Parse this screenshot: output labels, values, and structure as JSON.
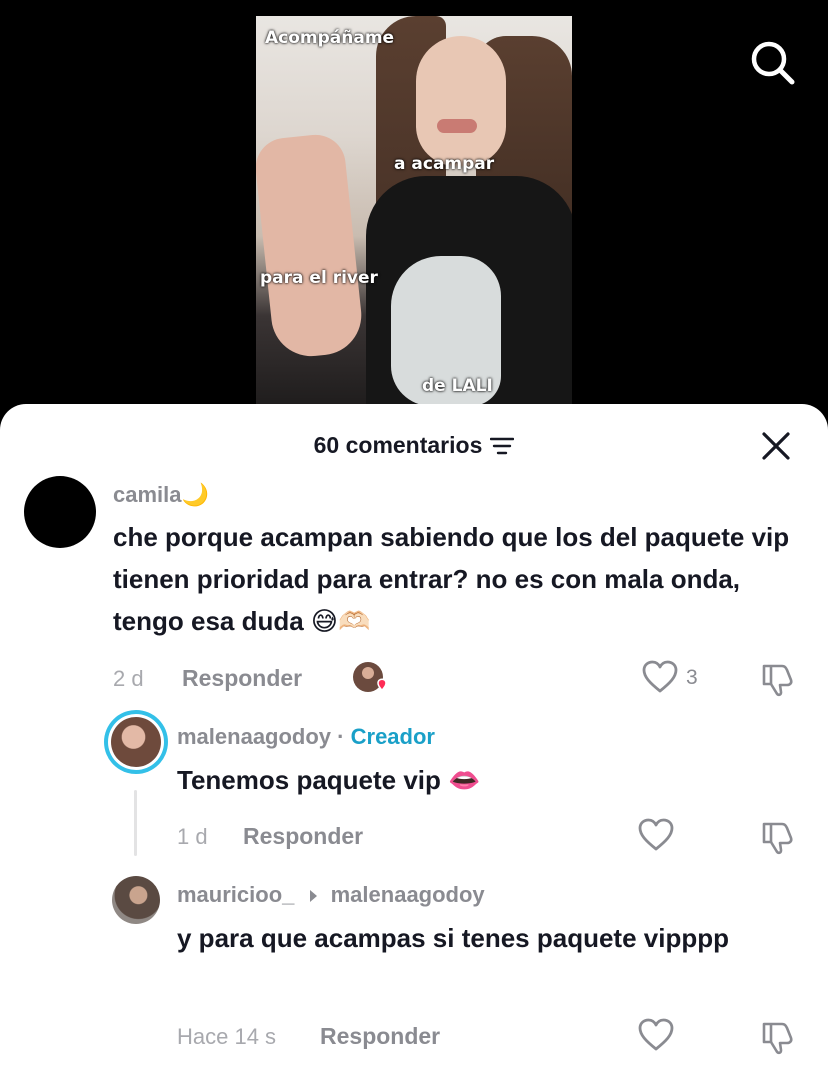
{
  "video": {
    "overlay_lines": [
      "Acompáñame",
      "a acampar",
      "para el river",
      "de LALI"
    ]
  },
  "header": {
    "comment_count": "60 comentarios"
  },
  "comments": [
    {
      "username": "camila🌙",
      "text": "che porque acampan sabiendo que los del paquete vip tienen prioridad para entrar? no es con mala onda, tengo esa duda 😅🫶🏻",
      "time": "2 d",
      "reply_label": "Responder",
      "likes": "3"
    },
    {
      "username": "malenaagodoy",
      "separator": "·",
      "badge": "Creador",
      "text": "Tenemos paquete vip 👄",
      "time": "1 d",
      "reply_label": "Responder"
    },
    {
      "username": "mauricioo_",
      "reply_to": "malenaagodoy",
      "text": "y para que acampas si tenes paquete vipppp",
      "time": "Hace 14 s",
      "reply_label": "Responder"
    }
  ],
  "colors": {
    "creator_badge": "#1aa0c8",
    "liked_heart": "#fe2c55",
    "text_primary": "#161823",
    "text_secondary": "#8a8b91"
  },
  "icons": [
    "search-icon",
    "filter-icon",
    "close-icon",
    "heart-icon",
    "dislike-icon",
    "reply-arrow-icon"
  ]
}
